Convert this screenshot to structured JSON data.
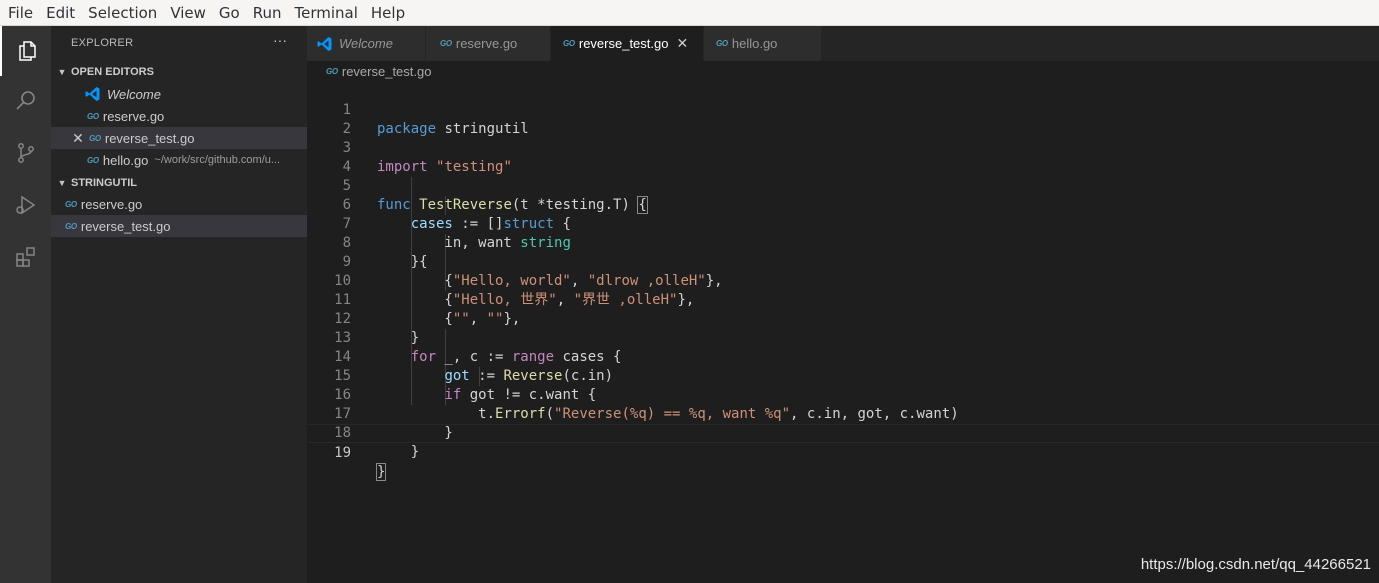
{
  "menu": [
    "File",
    "Edit",
    "Selection",
    "View",
    "Go",
    "Run",
    "Terminal",
    "Help"
  ],
  "activity_bar": {
    "items": [
      "files-icon",
      "search-icon",
      "source-control-icon",
      "run-debug-icon",
      "extensions-icon"
    ]
  },
  "sidebar": {
    "title": "EXPLORER",
    "more": "···",
    "open_editors": {
      "label": "OPEN EDITORS",
      "items": [
        {
          "name": "Welcome",
          "hint": ""
        },
        {
          "name": "reserve.go",
          "hint": ""
        },
        {
          "name": "reverse_test.go",
          "hint": ""
        },
        {
          "name": "hello.go",
          "hint": "~/work/src/github.com/u..."
        }
      ]
    },
    "folder": {
      "label": "STRINGUTIL",
      "items": [
        {
          "name": "reserve.go"
        },
        {
          "name": "reverse_test.go"
        }
      ]
    }
  },
  "go_badge": "GO",
  "tabs": [
    {
      "label": "Welcome"
    },
    {
      "label": "reserve.go"
    },
    {
      "label": "reverse_test.go"
    },
    {
      "label": "hello.go"
    }
  ],
  "tab_close": "✕",
  "breadcrumb": "reverse_test.go",
  "editor": {
    "line_numbers": [
      "1",
      "2",
      "3",
      "4",
      "5",
      "6",
      "7",
      "8",
      "9",
      "10",
      "11",
      "12",
      "13",
      "14",
      "15",
      "16",
      "17",
      "18",
      "19"
    ]
  },
  "watermark": "https://blog.csdn.net/qq_44266521",
  "colors": {
    "keyword": "#569cd6",
    "control": "#c586c0",
    "function": "#dcdcaa",
    "string": "#ce9178",
    "variable": "#9cdcfe",
    "type": "#4ec9b0",
    "go_icon": "#519aba",
    "vscode_icon": "#0098ff"
  }
}
